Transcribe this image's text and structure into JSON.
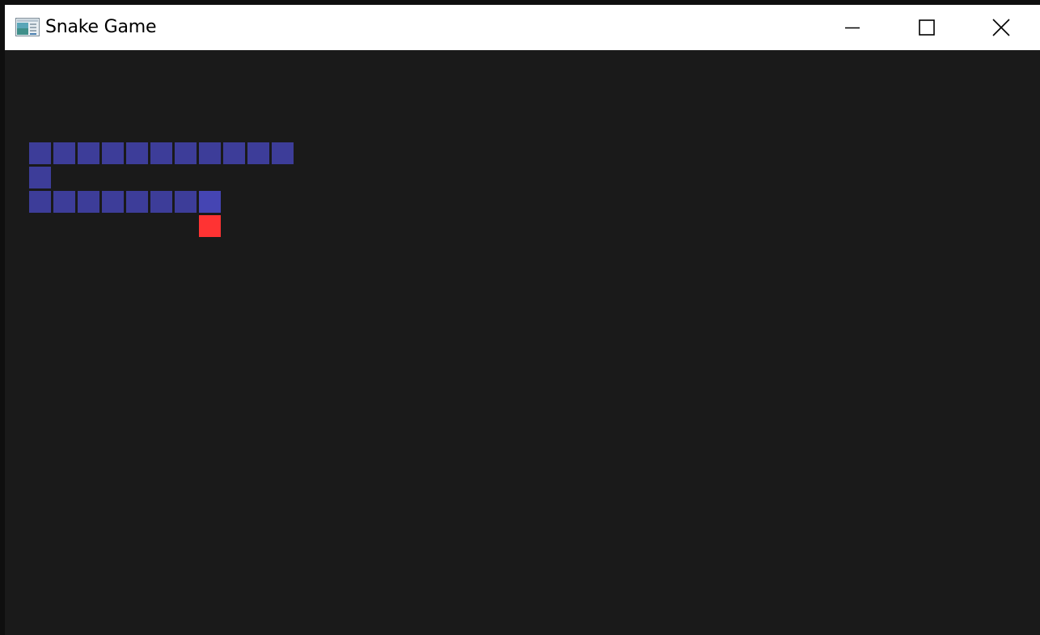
{
  "window": {
    "title": "Snake Game",
    "app_icon": "app-window-icon",
    "controls": {
      "minimize": "minimize-icon",
      "maximize": "maximize-icon",
      "close": "close-icon"
    }
  },
  "game": {
    "background_color": "#1a1a1a",
    "snake_color": "#3d3d99",
    "snake_head_color": "#4545b3",
    "food_color": "#ff3333",
    "snake_segments": [
      {
        "col": 7,
        "row": 19,
        "head": true
      },
      {
        "col": 6,
        "row": 19
      },
      {
        "col": 5,
        "row": 19
      },
      {
        "col": 4,
        "row": 19
      },
      {
        "col": 3,
        "row": 19
      },
      {
        "col": 2,
        "row": 19
      },
      {
        "col": 1,
        "row": 19
      },
      {
        "col": 0,
        "row": 19
      },
      {
        "col": 0,
        "row": 18
      },
      {
        "col": 0,
        "row": 17
      },
      {
        "col": 1,
        "row": 17
      },
      {
        "col": 2,
        "row": 17
      },
      {
        "col": 3,
        "row": 17
      },
      {
        "col": 4,
        "row": 17
      },
      {
        "col": 5,
        "row": 17
      },
      {
        "col": 6,
        "row": 17
      },
      {
        "col": 7,
        "row": 17
      },
      {
        "col": 8,
        "row": 17
      },
      {
        "col": 9,
        "row": 17
      },
      {
        "col": 10,
        "row": 17
      }
    ],
    "food": {
      "col": 7,
      "row": 20
    }
  }
}
